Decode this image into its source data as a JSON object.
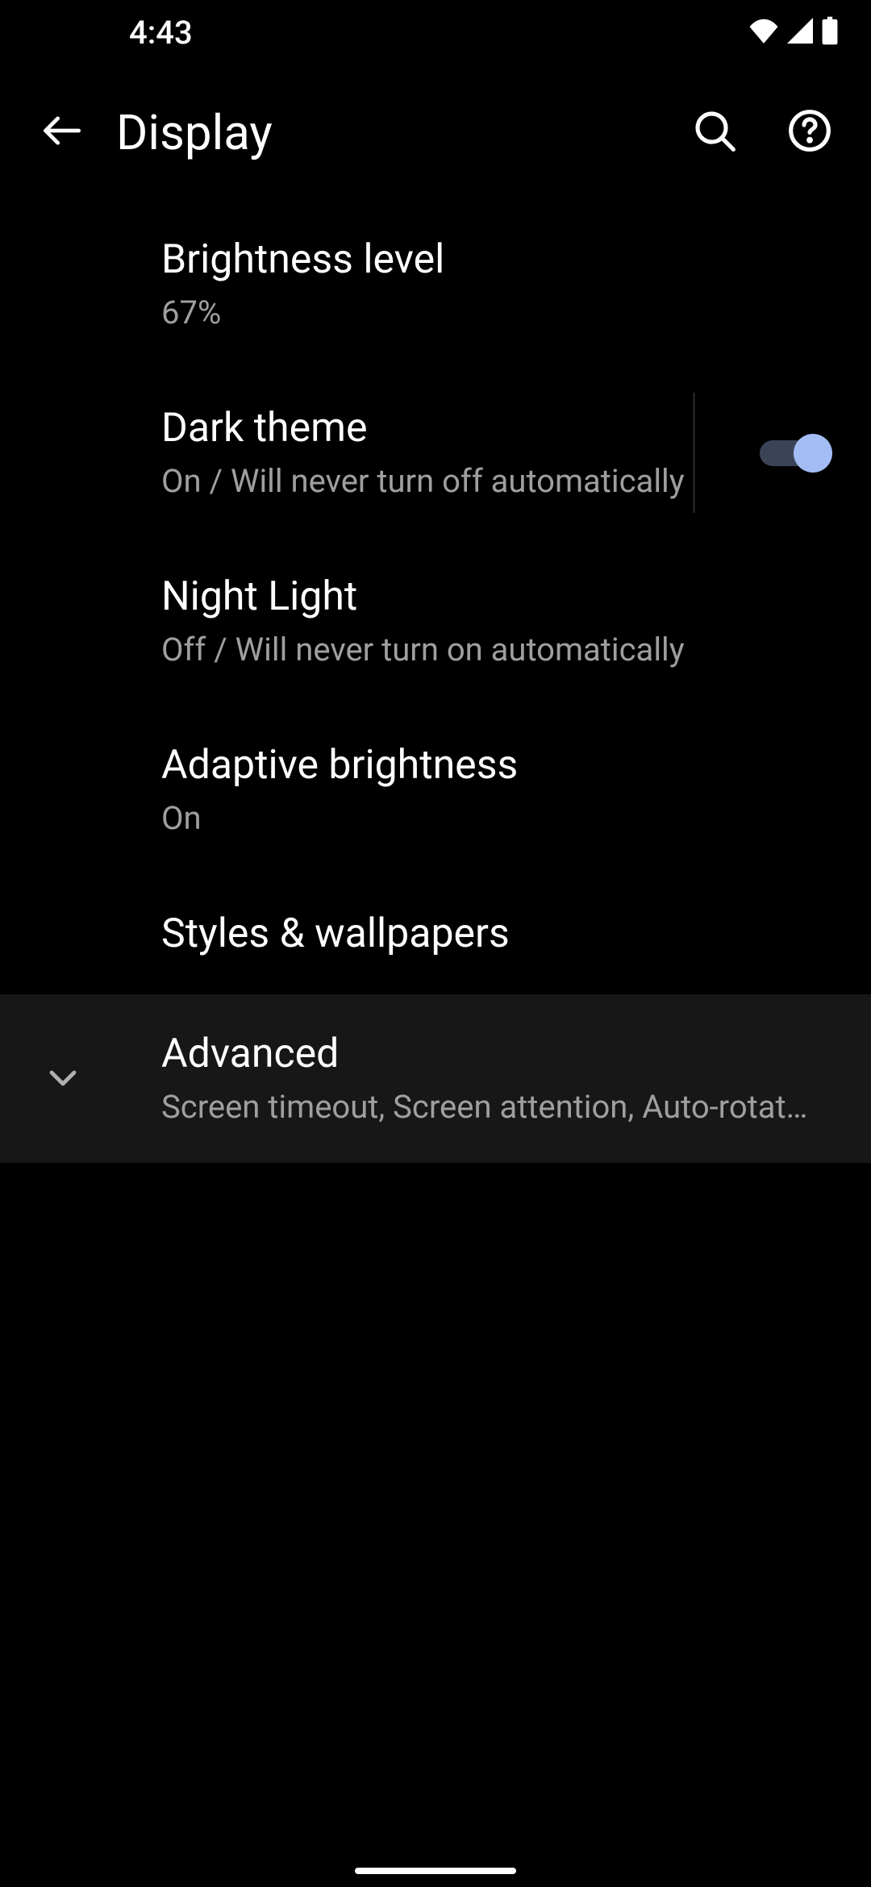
{
  "status_bar": {
    "time": "4:43"
  },
  "app_bar": {
    "title": "Display"
  },
  "settings": {
    "brightness": {
      "title": "Brightness level",
      "subtitle": "67%"
    },
    "dark_theme": {
      "title": "Dark theme",
      "subtitle": "On / Will never turn off automatically",
      "enabled": true
    },
    "night_light": {
      "title": "Night Light",
      "subtitle": "Off / Will never turn on automatically"
    },
    "adaptive_brightness": {
      "title": "Adaptive brightness",
      "subtitle": "On"
    },
    "styles_wallpapers": {
      "title": "Styles & wallpapers"
    },
    "advanced": {
      "title": "Advanced",
      "subtitle": "Screen timeout, Screen attention, Auto-rotate screen"
    }
  },
  "colors": {
    "toggle_thumb_on": "#a3bdf4",
    "toggle_track_on": "#3b4457",
    "advanced_bg": "#171717",
    "subtitle_text": "#9f9f9f"
  }
}
